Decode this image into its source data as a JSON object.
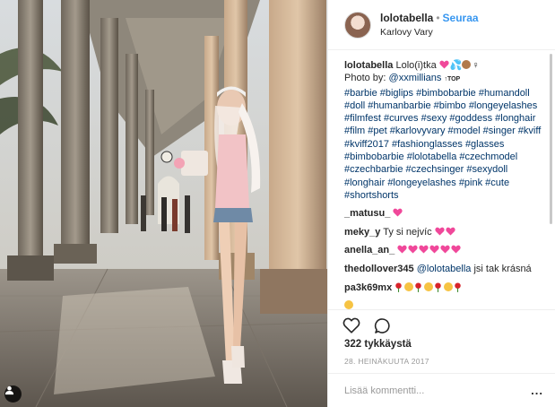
{
  "header": {
    "username": "lolotabella",
    "separator": "•",
    "follow_label": "Seuraa",
    "location": "Karlovy Vary"
  },
  "caption": {
    "username": "lolotabella",
    "text_start": "Lolo(i)tka",
    "emoji_after_text": "💖💦🏽♀",
    "photo_by_label": "Photo by:",
    "photo_by_user": "@xxmillians",
    "hashtags": "#barbie #biglips #bimbobarbie #humandoll #doll #humanbarbie #bimbo #longeyelashes #filmfest #curves #sexy #goddess #longhair #film #pet #karlovyvary #model #singer #kviff #kviff2017 #fashionglasses #glasses #bimbobarbie #lolotabella #czechmodel #czechbarbie #czechsinger #sexydoll #longhair #longeyelashes #pink #cute #shortshorts"
  },
  "comments": [
    {
      "user": "_matusu_",
      "text": "",
      "emoji": "💖"
    },
    {
      "user": "meky_y",
      "text": "Ty si nejvíc",
      "emoji": "💖💖"
    },
    {
      "user": "anella_an_",
      "text": "",
      "emoji": "💖💖💖💖💖💖"
    },
    {
      "user": "thedollover345",
      "mention": "@lolotabella",
      "text": "jsi tak krásná",
      "emoji": ""
    },
    {
      "user": "pa3k69mx",
      "text": "",
      "emoji": "🌹😘🌹😍🌹😘🌹"
    }
  ],
  "actions": {
    "like_icon": "heart-outline-icon",
    "comment_icon": "speech-bubble-icon"
  },
  "likes": "322 tykkäystä",
  "date": "28. HEINÄKUUTA 2017",
  "comment_box": {
    "placeholder": "Lisää kommentti...",
    "more_label": "..."
  },
  "colors": {
    "accent": "#3897f0",
    "hashtag": "#003569",
    "muted": "#999999",
    "heart_emoji": "#f0489a",
    "rose": "#d8232a"
  }
}
